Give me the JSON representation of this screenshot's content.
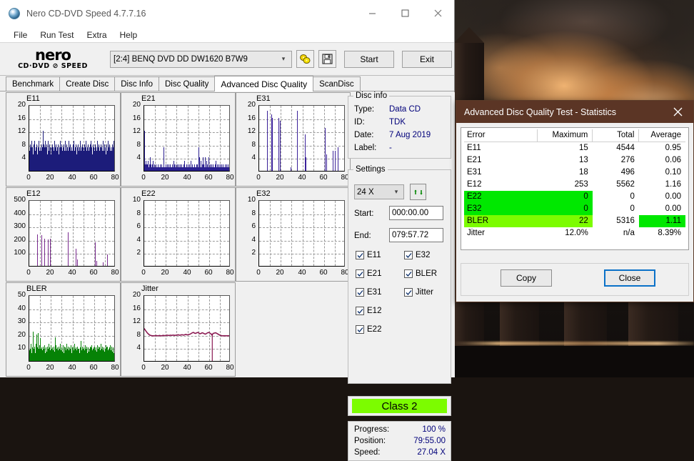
{
  "desktop": {
    "wallpaper_description": "city-skyline-at-dusk-wallpaper"
  },
  "window": {
    "title": "Nero CD-DVD Speed 4.7.7.16",
    "icon": "nero-disc-icon",
    "buttons": {
      "minimize": "minimize-icon",
      "maximize": "maximize-icon",
      "close": "close-icon"
    }
  },
  "menu": {
    "items": [
      "File",
      "Run Test",
      "Extra",
      "Help"
    ]
  },
  "logo": {
    "word": "nero",
    "subtitle": "CD·DVD ⊘ SPEED"
  },
  "toolbar": {
    "drive": "[2:4]   BENQ DVD DD DW1620 B7W9",
    "drive_index": "[2:4]",
    "drive_name": "BENQ DVD DD DW1620 B7W9",
    "disc_icon": "disc-speed-icon",
    "save_icon": "save-floppy-icon",
    "start_label": "Start",
    "exit_label": "Exit"
  },
  "tabs": [
    {
      "label": "Benchmark",
      "active": false
    },
    {
      "label": "Create Disc",
      "active": false
    },
    {
      "label": "Disc Info",
      "active": false
    },
    {
      "label": "Disc Quality",
      "active": false
    },
    {
      "label": "Advanced Disc Quality",
      "active": true
    },
    {
      "label": "ScanDisc",
      "active": false
    }
  ],
  "disc_info": {
    "legend": "Disc info",
    "rows": [
      {
        "label": "Type:",
        "value": "Data CD"
      },
      {
        "label": "ID:",
        "value": "TDK"
      },
      {
        "label": "Date:",
        "value": "7 Aug 2019"
      },
      {
        "label": "Label:",
        "value": "-"
      }
    ]
  },
  "settings": {
    "legend": "Settings",
    "speed": "24 X",
    "refresh_icon": "refresh-icon",
    "start_label": "Start:",
    "start_value": "000:00.00",
    "end_label": "End:",
    "end_value": "079:57.72",
    "checkboxes_left": [
      {
        "label": "E11",
        "checked": true
      },
      {
        "label": "E21",
        "checked": true
      },
      {
        "label": "E31",
        "checked": true
      },
      {
        "label": "E12",
        "checked": true
      },
      {
        "label": "E22",
        "checked": true
      }
    ],
    "checkboxes_right": [
      {
        "label": "E32",
        "checked": true
      },
      {
        "label": "BLER",
        "checked": true
      },
      {
        "label": "Jitter",
        "checked": true
      }
    ]
  },
  "class_badge": {
    "label": "Class 2",
    "color": "#7CFC00"
  },
  "progress": [
    {
      "label": "Progress:",
      "value": "100 %"
    },
    {
      "label": "Position:",
      "value": "79:55.00"
    },
    {
      "label": "Speed:",
      "value": "27.04 X"
    }
  ],
  "statistics_dialog": {
    "title": "Advanced Disc Quality Test - Statistics",
    "close_icon": "close-icon",
    "columns": [
      "Error",
      "Maximum",
      "Total",
      "Average"
    ],
    "rows": [
      {
        "error": "E11",
        "maximum": "15",
        "total": "4544",
        "average": "0.95",
        "highlight": "none"
      },
      {
        "error": "E21",
        "maximum": "13",
        "total": "276",
        "average": "0.06",
        "highlight": "none"
      },
      {
        "error": "E31",
        "maximum": "18",
        "total": "496",
        "average": "0.10",
        "highlight": "none"
      },
      {
        "error": "E12",
        "maximum": "253",
        "total": "5562",
        "average": "1.16",
        "highlight": "none"
      },
      {
        "error": "E22",
        "maximum": "0",
        "total": "0",
        "average": "0.00",
        "highlight": "green"
      },
      {
        "error": "E32",
        "maximum": "0",
        "total": "0",
        "average": "0.00",
        "highlight": "green"
      },
      {
        "error": "BLER",
        "maximum": "22",
        "total": "5316",
        "average": "1.11",
        "highlight": "lightgreen-avg-green"
      },
      {
        "error": "Jitter",
        "maximum": "12.0%",
        "total": "n/a",
        "average": "8.39%",
        "highlight": "none"
      }
    ],
    "copy_label": "Copy",
    "close_label": "Close"
  },
  "chart_data": [
    {
      "type": "bar",
      "title": "E11",
      "xlabel": "",
      "ylabel": "",
      "xlim": [
        0,
        80
      ],
      "ylim": [
        0,
        20
      ],
      "xticks": [
        "0",
        "20",
        "40",
        "60",
        "80"
      ],
      "yticks": [
        "4",
        "8",
        "12",
        "16",
        "20"
      ],
      "color": "#1c1c7a",
      "grid": true,
      "values": [
        6,
        5,
        8,
        7,
        5,
        9,
        6,
        7,
        5,
        8,
        6,
        7,
        9,
        6,
        5,
        7,
        6,
        8,
        5,
        6,
        7,
        5,
        9,
        6,
        7,
        5,
        6,
        8,
        5,
        7,
        6,
        12,
        8,
        5,
        7,
        6,
        9,
        5,
        7,
        6,
        8,
        5,
        7,
        9,
        6,
        5,
        8,
        7,
        6,
        5,
        7,
        6,
        8,
        5,
        7,
        6,
        5,
        9,
        6,
        7,
        5,
        8,
        6,
        7,
        5,
        6,
        8,
        5,
        7,
        6,
        9,
        5,
        7,
        6,
        8,
        5,
        6,
        7,
        5,
        8,
        6,
        7,
        9,
        5,
        6,
        8,
        5,
        7,
        6,
        5,
        9,
        7,
        6,
        5,
        8,
        6,
        7,
        5,
        6,
        8,
        5,
        7,
        9,
        6,
        5,
        7,
        6,
        8,
        5,
        6,
        7,
        5,
        8,
        6,
        7,
        5,
        9,
        6,
        5,
        7,
        6,
        8,
        5,
        7,
        6,
        5,
        8,
        7,
        6,
        9,
        5,
        6,
        7,
        5,
        8,
        6,
        5,
        7,
        6,
        8,
        5,
        9,
        6,
        7,
        5,
        6,
        8,
        5,
        7,
        6,
        5,
        8,
        7,
        6,
        5,
        9,
        6,
        7,
        5,
        8,
        6,
        5,
        7,
        6,
        8,
        5,
        7,
        6,
        9,
        5,
        6,
        8,
        5,
        7,
        6,
        5,
        7,
        8,
        6,
        5,
        9,
        7,
        6,
        5,
        8,
        6,
        7,
        5,
        6,
        8,
        5,
        7,
        6,
        9,
        5,
        7,
        6,
        8
      ]
    },
    {
      "type": "bar",
      "title": "E21",
      "xlabel": "",
      "ylabel": "",
      "xlim": [
        0,
        80
      ],
      "ylim": [
        0,
        20
      ],
      "xticks": [
        "0",
        "20",
        "40",
        "60",
        "80"
      ],
      "yticks": [
        "4",
        "8",
        "12",
        "16",
        "20"
      ],
      "color": "#2a1f8f",
      "grid": true,
      "values": [
        12,
        1,
        2,
        1,
        3,
        2,
        1,
        2,
        1,
        3,
        1,
        2,
        1,
        4,
        1,
        2,
        1,
        1,
        2,
        1,
        3,
        1,
        1,
        2,
        1,
        1,
        1,
        2,
        1,
        1,
        1,
        2,
        1,
        1,
        1,
        1,
        2,
        1,
        1,
        1,
        2,
        1,
        1,
        1,
        7,
        2,
        1,
        1,
        1,
        2,
        1,
        1,
        1,
        2,
        1,
        1,
        2,
        1,
        1,
        1,
        2,
        1,
        1,
        1,
        1,
        2,
        1,
        1,
        3,
        2,
        1,
        1,
        2,
        1,
        1,
        1,
        2,
        1,
        1,
        2,
        1,
        1,
        2,
        1,
        1,
        1,
        2,
        1,
        1,
        1,
        1,
        2,
        1,
        3,
        1,
        1,
        1,
        2,
        1,
        1,
        2,
        1,
        1,
        1,
        2,
        1,
        1,
        2,
        3,
        1,
        1,
        2,
        1,
        1,
        1,
        2,
        1,
        1,
        1,
        1,
        2,
        1,
        1,
        2,
        1,
        6,
        7,
        4,
        2,
        1,
        3,
        2,
        1,
        1,
        2,
        4,
        3,
        1,
        2,
        1,
        4,
        2,
        1,
        3,
        1,
        2,
        1,
        1,
        4,
        2,
        1,
        1,
        2,
        1,
        1,
        2,
        1,
        1,
        1,
        2,
        1,
        1,
        1,
        2,
        1,
        3,
        1,
        1,
        2,
        1,
        1,
        1,
        2,
        1,
        1,
        2,
        1,
        1,
        1,
        2,
        1,
        1,
        2,
        1,
        1,
        1,
        2,
        1,
        1,
        1,
        2,
        1,
        1,
        2,
        1,
        1,
        1,
        2,
        1,
        4
      ]
    },
    {
      "type": "bar",
      "title": "E31",
      "xlabel": "",
      "ylabel": "",
      "xlim": [
        0,
        80
      ],
      "ylim": [
        0,
        20
      ],
      "xticks": [
        "0",
        "20",
        "40",
        "60",
        "80"
      ],
      "yticks": [
        "4",
        "8",
        "12",
        "16",
        "20"
      ],
      "color": "#3b2199",
      "grid": true,
      "spikes": [
        {
          "x": 7,
          "y": 18
        },
        {
          "x": 11,
          "y": 17
        },
        {
          "x": 12,
          "y": 16
        },
        {
          "x": 18,
          "y": 16
        },
        {
          "x": 19,
          "y": 15
        },
        {
          "x": 29,
          "y": 1
        },
        {
          "x": 35,
          "y": 18
        },
        {
          "x": 42,
          "y": 11
        },
        {
          "x": 43,
          "y": 4
        },
        {
          "x": 61,
          "y": 13
        },
        {
          "x": 62,
          "y": 5
        },
        {
          "x": 68,
          "y": 6
        },
        {
          "x": 70,
          "y": 6
        },
        {
          "x": 73,
          "y": 7
        }
      ]
    },
    {
      "type": "bar",
      "title": "E12",
      "xlabel": "",
      "ylabel": "",
      "xlim": [
        0,
        80
      ],
      "ylim": [
        0,
        500
      ],
      "xticks": [
        "0",
        "20",
        "40",
        "60",
        "80"
      ],
      "yticks": [
        "100",
        "200",
        "300",
        "400",
        "500"
      ],
      "color": "#7a2a8f",
      "grid": true,
      "spikes": [
        {
          "x": 7,
          "y": 235
        },
        {
          "x": 11,
          "y": 232
        },
        {
          "x": 14,
          "y": 205
        },
        {
          "x": 17,
          "y": 200
        },
        {
          "x": 19,
          "y": 205
        },
        {
          "x": 36,
          "y": 252
        },
        {
          "x": 43,
          "y": 128
        },
        {
          "x": 44,
          "y": 50
        },
        {
          "x": 61,
          "y": 180
        },
        {
          "x": 62,
          "y": 35
        },
        {
          "x": 68,
          "y": 25
        },
        {
          "x": 72,
          "y": 85
        }
      ]
    },
    {
      "type": "bar",
      "title": "E22",
      "xlabel": "",
      "ylabel": "",
      "xlim": [
        0,
        80
      ],
      "ylim": [
        0,
        10
      ],
      "xticks": [
        "0",
        "20",
        "40",
        "60",
        "80"
      ],
      "yticks": [
        "2",
        "4",
        "6",
        "8",
        "10"
      ],
      "color": "#1c1c7a",
      "grid": true,
      "values": []
    },
    {
      "type": "bar",
      "title": "E32",
      "xlabel": "",
      "ylabel": "",
      "xlim": [
        0,
        80
      ],
      "ylim": [
        0,
        10
      ],
      "xticks": [
        "0",
        "20",
        "40",
        "60",
        "80"
      ],
      "yticks": [
        "2",
        "4",
        "6",
        "8",
        "10"
      ],
      "color": "#1c1c7a",
      "grid": true,
      "values": []
    },
    {
      "type": "bar",
      "title": "BLER",
      "xlabel": "",
      "ylabel": "",
      "xlim": [
        0,
        80
      ],
      "ylim": [
        0,
        50
      ],
      "xticks": [
        "0",
        "20",
        "40",
        "60",
        "80"
      ],
      "yticks": [
        "10",
        "20",
        "30",
        "40",
        "50"
      ],
      "color": "#068206",
      "grid": true,
      "values": [
        8,
        6,
        9,
        13,
        7,
        6,
        10,
        8,
        22,
        9,
        7,
        11,
        8,
        6,
        13,
        9,
        7,
        20,
        10,
        8,
        21,
        9,
        7,
        12,
        8,
        17,
        9,
        7,
        10,
        8,
        6,
        11,
        9,
        7,
        12,
        8,
        6,
        10,
        9,
        7,
        11,
        8,
        6,
        9,
        13,
        7,
        10,
        8,
        6,
        12,
        9,
        7,
        10,
        8,
        6,
        11,
        9,
        7,
        18,
        10,
        8,
        12,
        9,
        7,
        10,
        8,
        6,
        11,
        9,
        7,
        13,
        8,
        6,
        10,
        9,
        7,
        12,
        8,
        6,
        9,
        11,
        7,
        10,
        8,
        6,
        13,
        9,
        7,
        11,
        8,
        6,
        10,
        9,
        7,
        12,
        8,
        6,
        9,
        10,
        7,
        11,
        8,
        6,
        13,
        9,
        7,
        10,
        8,
        6,
        11,
        9,
        7,
        9,
        8,
        6,
        10,
        9,
        7,
        15,
        8,
        6,
        11,
        9,
        7,
        10,
        8,
        6,
        12,
        9,
        7,
        11,
        8,
        6,
        10,
        9,
        7,
        9,
        8,
        6,
        11,
        10,
        7,
        12,
        8,
        6,
        9,
        10,
        7,
        11,
        8,
        6,
        10,
        9,
        7,
        12,
        8,
        6,
        9,
        11,
        7,
        10,
        8,
        6,
        13,
        9,
        7,
        11,
        8,
        6,
        10,
        9,
        7,
        9,
        8,
        6,
        12,
        10,
        7,
        11,
        8,
        6,
        9,
        10,
        7,
        12,
        8,
        6,
        11,
        9,
        7,
        10,
        8,
        6,
        13,
        9,
        7,
        12
      ]
    },
    {
      "type": "line",
      "title": "Jitter",
      "xlabel": "",
      "ylabel": "",
      "xlim": [
        0,
        80
      ],
      "ylim": [
        0,
        20
      ],
      "xticks": [
        "0",
        "20",
        "40",
        "60",
        "80"
      ],
      "yticks": [
        "4",
        "8",
        "12",
        "16",
        "20"
      ],
      "color": "#8b1a52",
      "grid": true,
      "values": [
        10.2,
        9.7,
        9.2,
        8.8,
        8.5,
        8.2,
        8.1,
        8.0,
        8.0,
        8.0,
        8.0,
        8.1,
        8.0,
        8.0,
        8.1,
        8.0,
        8.0,
        8.1,
        8.1,
        8.0,
        8.1,
        8.2,
        8.1,
        8.1,
        8.2,
        8.1,
        8.2,
        8.2,
        8.1,
        8.2,
        8.2,
        8.3,
        8.2,
        8.2,
        8.3,
        8.3,
        8.2,
        8.3,
        8.4,
        8.3,
        8.3,
        8.4,
        8.5,
        8.7,
        8.9,
        9.0,
        8.8,
        8.7,
        8.9,
        9.0,
        8.8,
        8.6,
        8.7,
        8.9,
        8.8,
        8.6,
        8.5,
        8.7,
        8.9,
        9.0,
        8.8,
        8.6,
        8.2,
        8.7,
        8.8,
        8.9,
        8.8,
        8.6,
        8.4,
        8.2,
        8.1,
        8.0,
        8.0,
        8.0,
        8.0,
        8.0,
        8.0,
        8.0,
        8.0,
        8.0
      ]
    }
  ]
}
